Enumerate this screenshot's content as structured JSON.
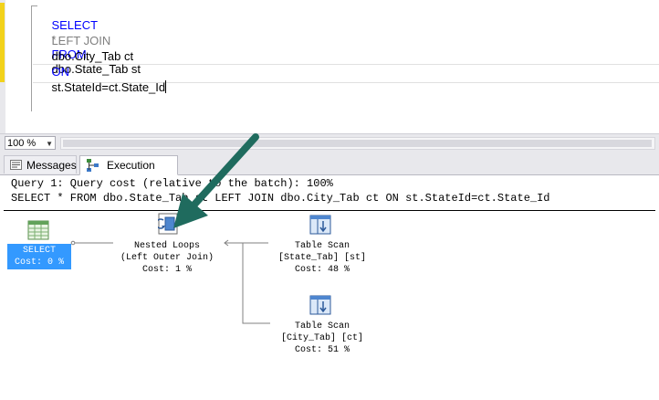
{
  "editor": {
    "lines": [
      {
        "kw1": "SELECT",
        "op": "*",
        "kw2": "FROM",
        "rest": "dbo.State_Tab st"
      },
      {
        "kw": "LEFT JOIN"
      },
      {
        "text": "dbo.City_Tab ct"
      },
      {
        "kw": "ON"
      },
      {
        "text": "st.StateId=ct.State_Id"
      }
    ]
  },
  "zoom": {
    "value": "100 %"
  },
  "tabs": {
    "messages": "Messages",
    "execution_plan": "Execution plan",
    "active": "Execution plan"
  },
  "plan": {
    "query_header": "Query 1: Query cost (relative to the batch): 100%",
    "query_text": "SELECT * FROM dbo.State_Tab st LEFT JOIN dbo.City_Tab ct ON st.StateId=ct.State_Id",
    "nodes": {
      "select": {
        "name": "SELECT",
        "cost": "Cost: 0 %"
      },
      "nested_loops": {
        "name": "Nested Loops",
        "detail": "(Left Outer Join)",
        "cost": "Cost: 1 %"
      },
      "scan_state": {
        "name": "Table Scan",
        "detail": "[State_Tab] [st]",
        "cost": "Cost: 48 %"
      },
      "scan_city": {
        "name": "Table Scan",
        "detail": "[City_Tab] [ct]",
        "cost": "Cost: 51 %"
      }
    }
  },
  "colors": {
    "keyword": "#0000ff",
    "keyword_gray": "#808080",
    "selection": "#3399ff",
    "arrow": "#1f6b5e",
    "change_marker": "#f2d21b"
  },
  "icons": {
    "select_node": "table-grid-icon",
    "nested_loops_node": "nested-loops-icon",
    "table_scan_node": "table-scan-icon",
    "annotation": "teal-arrow-icon"
  }
}
